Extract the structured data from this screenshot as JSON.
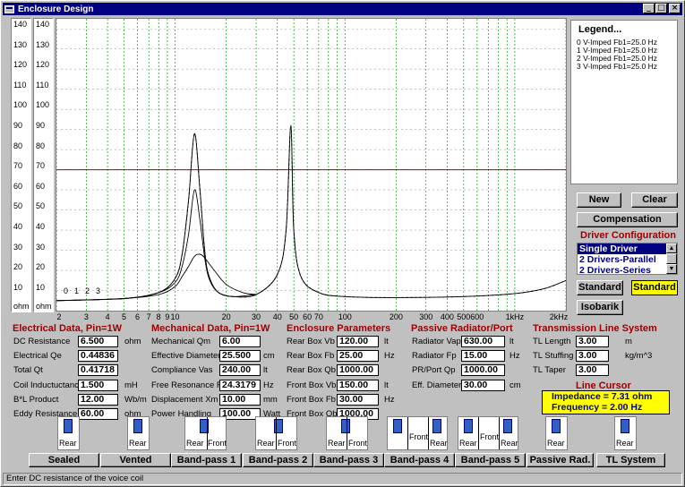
{
  "window": {
    "title": "Enclosure Design"
  },
  "scales": {
    "left_ticks": [
      "140",
      "130",
      "120",
      "110",
      "100",
      "90",
      "80",
      "70",
      "60",
      "50",
      "40",
      "30",
      "20",
      "10"
    ],
    "right_ticks": [
      "140",
      "130",
      "120",
      "110",
      "100",
      "90",
      "80",
      "70",
      "60",
      "50",
      "40",
      "30",
      "20",
      "10"
    ],
    "unit": "ohm"
  },
  "chart_data": {
    "type": "line",
    "x_scale": "log",
    "xlim": [
      2,
      2000
    ],
    "ylim": [
      0,
      145
    ],
    "x_tick_labels": [
      "2",
      "3",
      "4",
      "5",
      "6",
      "7",
      "8",
      "9",
      "10",
      "20",
      "30",
      "40",
      "50",
      "60",
      "70",
      "100",
      "200",
      "300",
      "400",
      "500",
      "600",
      "1kHz",
      "2kHz"
    ],
    "x_ticks": [
      2,
      3,
      4,
      5,
      6,
      7,
      8,
      9,
      10,
      20,
      30,
      40,
      50,
      60,
      70,
      100,
      200,
      300,
      400,
      500,
      600,
      1000,
      2000
    ],
    "ref_line": 70,
    "grid": true,
    "curve_labels": [
      "0",
      "1",
      "2",
      "3"
    ],
    "series": [
      {
        "x": [
          2,
          5,
          8,
          10,
          11,
          12,
          13,
          14,
          15,
          16,
          18,
          22,
          30,
          40,
          45,
          48,
          50,
          55,
          70,
          100,
          200,
          500,
          1000,
          1500,
          2000
        ],
        "y": [
          5,
          6,
          9,
          16,
          28,
          55,
          88,
          60,
          28,
          16,
          9,
          7,
          8,
          18,
          40,
          92,
          40,
          17,
          9,
          7,
          6.5,
          7,
          8.5,
          11,
          15
        ]
      },
      {
        "x": [
          2,
          5,
          8,
          10,
          11,
          12,
          13,
          14,
          15,
          16,
          18,
          22,
          30,
          40,
          45,
          48,
          50,
          55,
          70,
          100,
          200,
          500,
          1000,
          1500,
          2000
        ],
        "y": [
          5,
          6,
          9,
          16,
          28,
          55,
          88,
          60,
          28,
          16,
          9,
          7,
          8,
          18,
          40,
          92,
          40,
          17,
          9,
          7,
          6.5,
          7,
          8.5,
          11,
          15
        ]
      },
      {
        "x": [
          2,
          5,
          8,
          10,
          11,
          12,
          13,
          14,
          15,
          16,
          18,
          22,
          30
        ],
        "y": [
          5,
          6,
          9,
          14,
          22,
          38,
          60,
          45,
          25,
          15,
          9,
          7,
          8
        ]
      },
      {
        "x": [
          2,
          5,
          8,
          10,
          11,
          12,
          13,
          14,
          15,
          17,
          20,
          25,
          30
        ],
        "y": [
          5,
          6,
          8,
          12,
          17,
          22,
          27,
          28,
          26,
          20,
          13,
          9,
          8
        ]
      }
    ]
  },
  "legend": {
    "title": "Legend...",
    "items": [
      "0 V-Imped Fb1=25.0 Hz",
      "1 V-Imped Fb1=25.0 Hz",
      "2 V-Imped Fb1=25.0 Hz",
      "3 V-Imped Fb1=25.0 Hz"
    ]
  },
  "buttons": {
    "new": "New",
    "clear": "Clear",
    "compensation": "Compensation",
    "standard1": "Standard",
    "standard2": "Standard",
    "isobarik": "Isobarik"
  },
  "driver_config": {
    "title": "Driver Configuration",
    "options": [
      "Single Driver",
      "2 Drivers-Parallel",
      "2 Drivers-Series"
    ]
  },
  "electrical": {
    "title": "Electrical Data, Pin=1W",
    "rows": [
      {
        "label": "DC Resistance",
        "value": "6.500",
        "unit": "ohm"
      },
      {
        "label": "Electrical Qe",
        "value": "0.44836",
        "unit": ""
      },
      {
        "label": "Total Qt",
        "value": "0.41718",
        "unit": ""
      },
      {
        "label": "Coil Inductuctance",
        "value": "1.500",
        "unit": "mH"
      },
      {
        "label": "B*L Product",
        "value": "12.00",
        "unit": "Wb/m"
      },
      {
        "label": "Eddy Resistance",
        "value": "60.00",
        "unit": "ohm"
      }
    ]
  },
  "mechanical": {
    "title": "Mechanical Data, Pin=1W",
    "rows": [
      {
        "label": "Mechanical Qm",
        "value": "6.00",
        "unit": ""
      },
      {
        "label": "Effective Diameter",
        "value": "25.500",
        "unit": "cm"
      },
      {
        "label": "Compliance Vas",
        "value": "240.00",
        "unit": "lt"
      },
      {
        "label": "Free Resonance Fs",
        "value": "24.3179",
        "unit": "Hz"
      },
      {
        "label": "Displacement Xm",
        "value": "10.00",
        "unit": "mm"
      },
      {
        "label": "Power Handling",
        "value": "100.00",
        "unit": "Watt"
      }
    ]
  },
  "enclosure": {
    "title": "Enclosure Parameters",
    "rows": [
      {
        "label": "Rear Box Vb",
        "value": "120.00",
        "unit": "lt"
      },
      {
        "label": "Rear Box Fb",
        "value": "25.00",
        "unit": "Hz"
      },
      {
        "label": "Rear Box Qb",
        "value": "1000.00",
        "unit": ""
      },
      {
        "label": "Front Box Vb",
        "value": "150.00",
        "unit": "lt"
      },
      {
        "label": "Front Box Fb",
        "value": "30.00",
        "unit": "Hz"
      },
      {
        "label": "Front Box Qb",
        "value": "1000.00",
        "unit": ""
      }
    ]
  },
  "passive": {
    "title": "Passive Radiator/Port",
    "rows": [
      {
        "label": "Radiator Vap",
        "value": "630.00",
        "unit": "lt"
      },
      {
        "label": "Radiator Fp",
        "value": "15.00",
        "unit": "Hz"
      },
      {
        "label": "PR/Port Qp",
        "value": "1000.00",
        "unit": ""
      },
      {
        "label": "Eff. Diameter",
        "value": "30.00",
        "unit": "cm"
      }
    ]
  },
  "transmission": {
    "title": "Transmission Line System",
    "rows": [
      {
        "label": "TL Length",
        "value": "3.00",
        "unit": "m"
      },
      {
        "label": "TL Stuffing",
        "value": "3.00",
        "unit": "kg/m^3"
      },
      {
        "label": "TL Taper",
        "value": "3.00",
        "unit": ""
      }
    ]
  },
  "line_cursor": {
    "title": "Line Cursor",
    "impedance": "Impedance = 7.31 ohm",
    "frequency": "Frequency = 2.00 Hz"
  },
  "enclosure_types": {
    "buttons": [
      "Sealed",
      "Vented",
      "Band-pass 1",
      "Band-pass 2",
      "Band-pass 3",
      "Band-pass 4",
      "Band-pass 5",
      "Passive Rad.",
      "TL System"
    ],
    "rear": "Rear",
    "front": "Front"
  },
  "status": "Enter DC resistance of the voice coil",
  "colors": {
    "accent_red": "#a00000",
    "title_bar": "#000080",
    "cursor_bg": "#ffff00"
  }
}
